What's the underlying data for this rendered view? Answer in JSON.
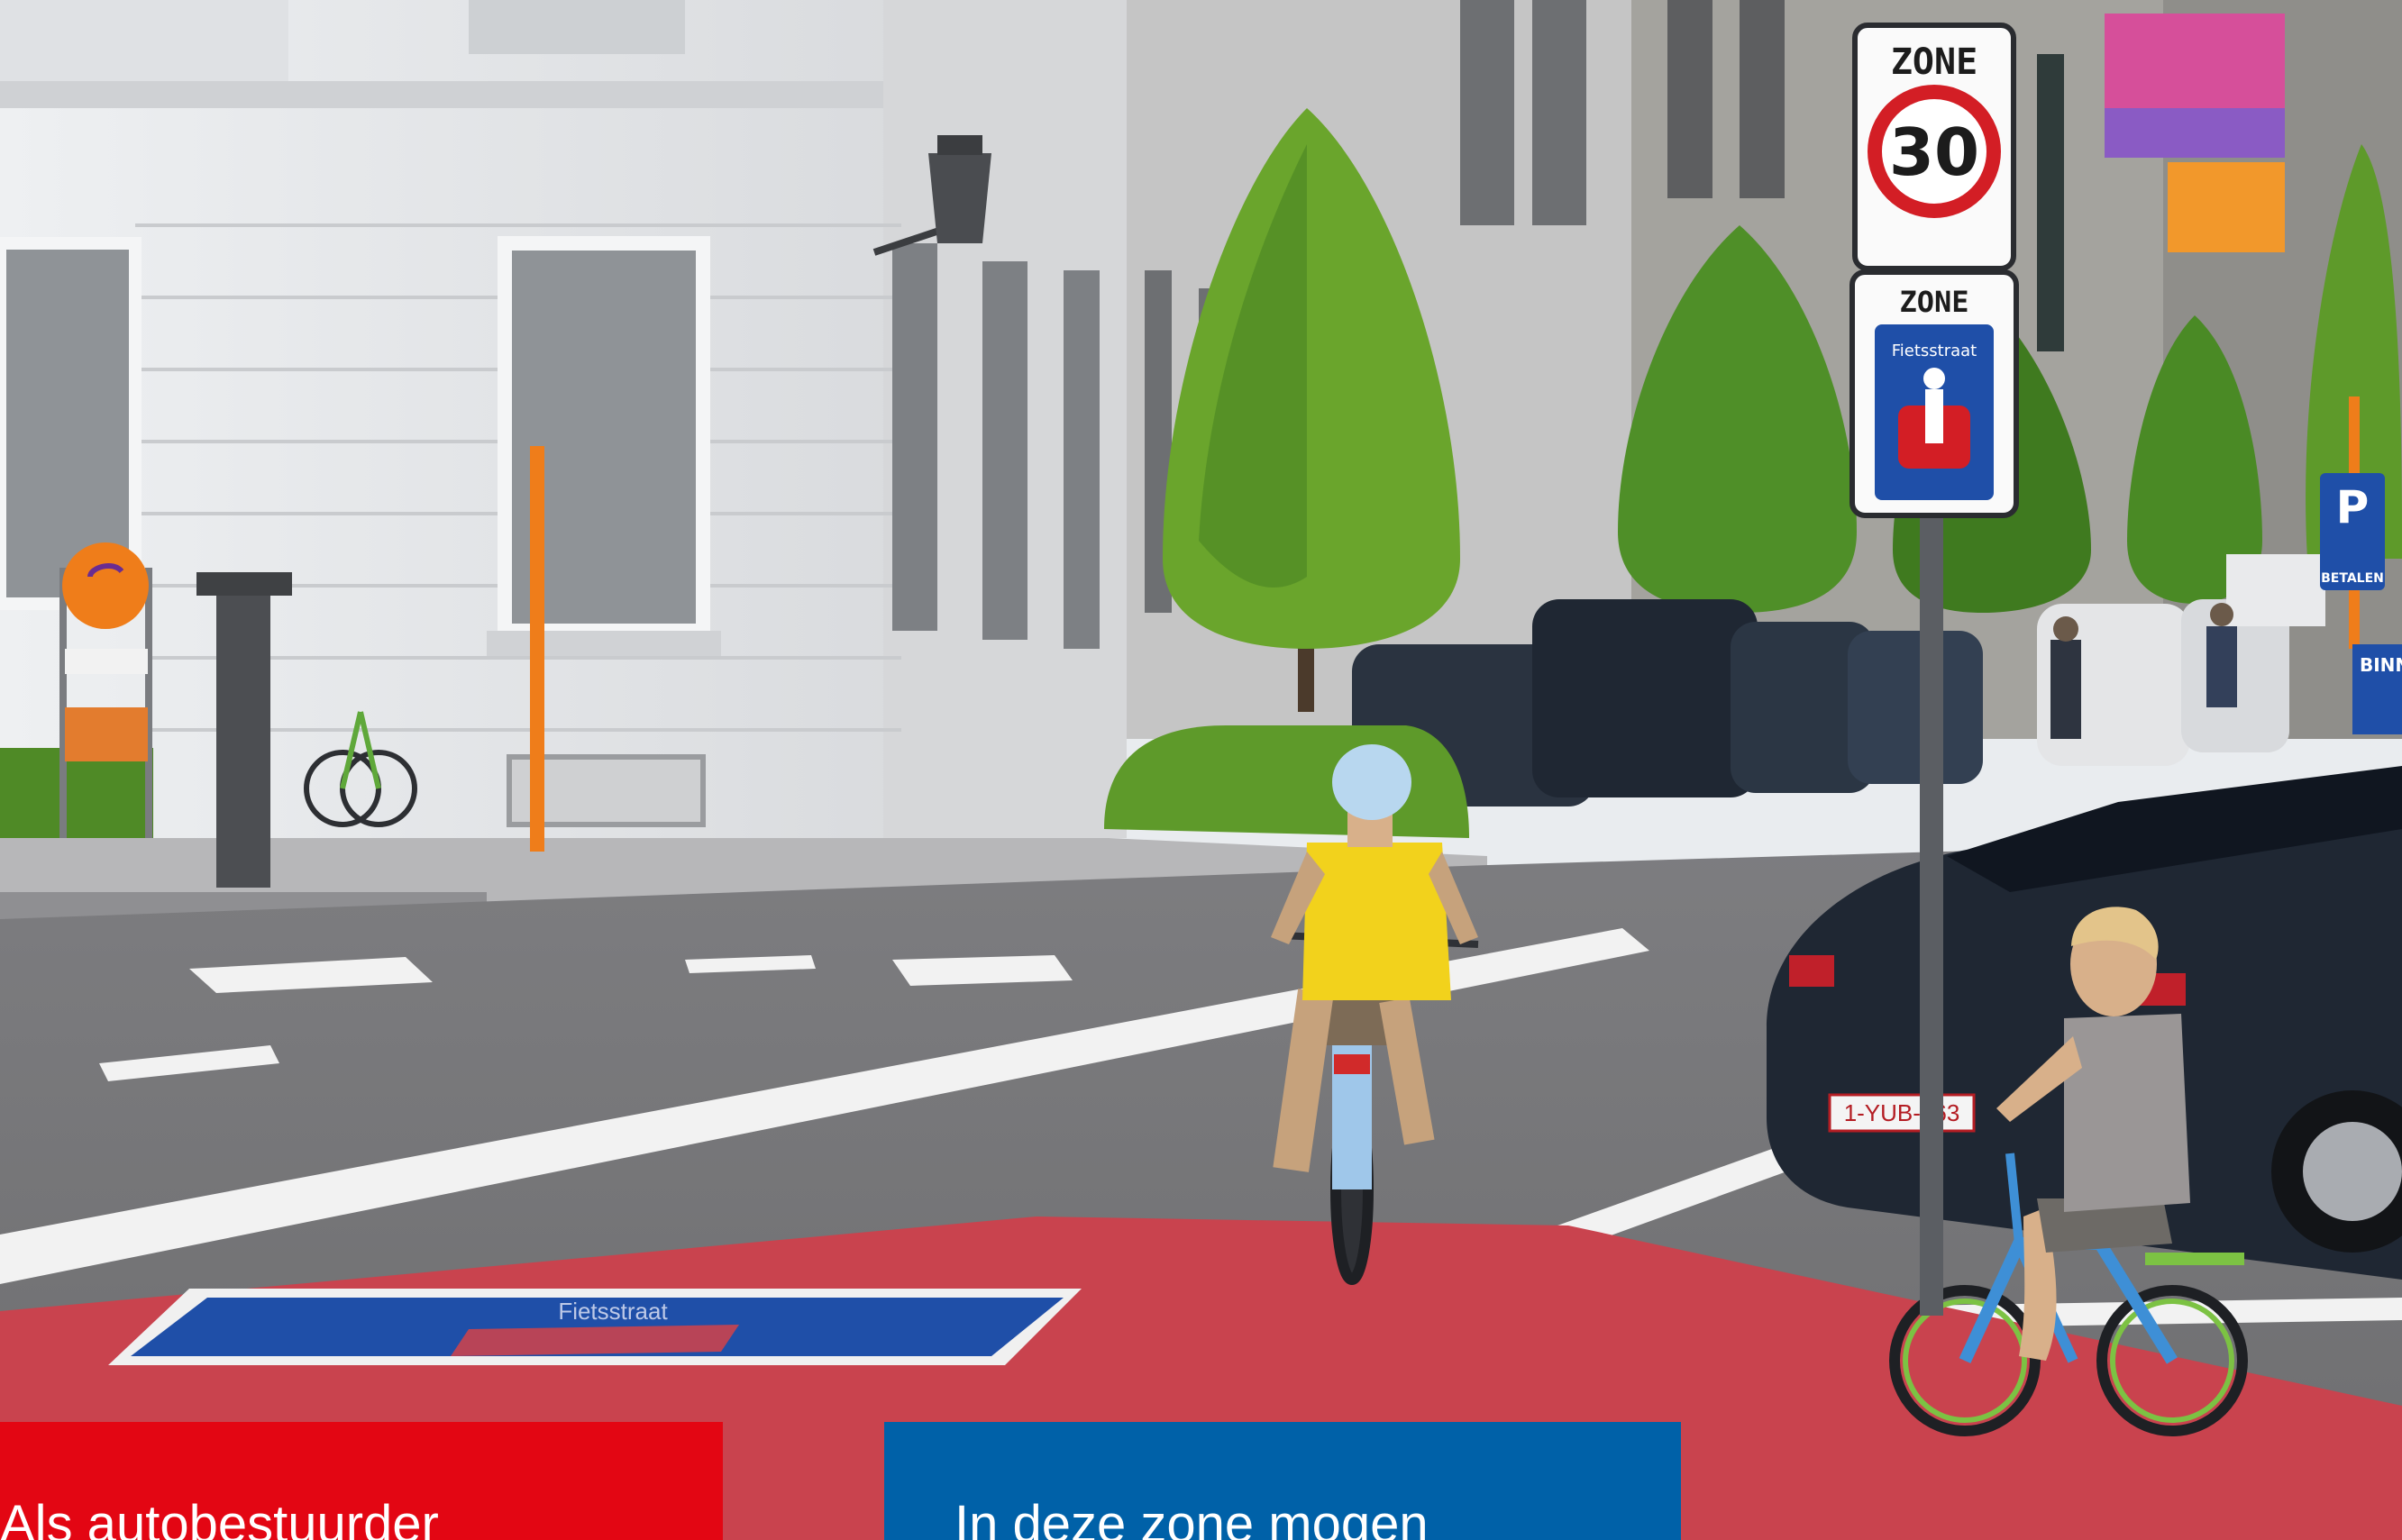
{
  "colors": {
    "sky": "#e9ecef",
    "building_left": "#e7e9ec",
    "building_mid": "#c5c5c5",
    "building_right": "#a4a39e",
    "asphalt": "#6e6e70",
    "asphalt_far": "#7d7d80",
    "cycle_street_red": "#c9434e",
    "road_marking_white": "#f2f2f2",
    "tree_green": "#6aa52c",
    "tree_dark": "#3f7a1f",
    "hedge_green": "#5e9a2a",
    "sign_blue": "#1f4fa8",
    "sign_red": "#d31e25",
    "pole_orange": "#ef7d1a",
    "car_dark": "#1f2733",
    "helmet_blue": "#b8d7ef",
    "shirt_yellow": "#f2d21c",
    "shirt_gray": "#9a9696",
    "panel_red": "#e30613",
    "panel_blue": "#0061a8"
  },
  "signs": {
    "zone30_top": "ZONE",
    "zone30_number": "30",
    "fietsstraat_top": "ZONE",
    "fietsstraat_label": "Fietsstraat",
    "parking_letter": "P",
    "parking_label": "BETALEN",
    "road_marking_text": "Fietsstraat",
    "corner_sign_text": "BINN FIE",
    "license_plate": "1-YUB-663"
  },
  "captions": {
    "left": "Als autobestuurder",
    "right": "In deze zone mogen"
  }
}
